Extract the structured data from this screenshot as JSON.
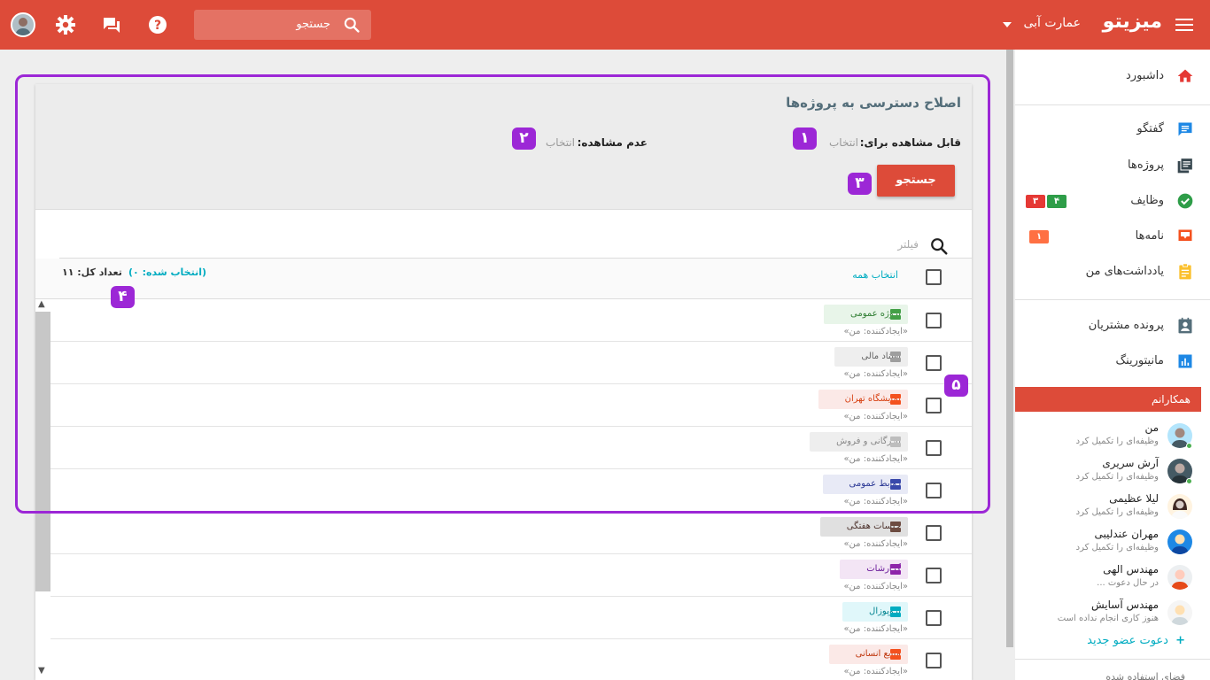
{
  "topbar": {
    "brand": "میزیتو",
    "org": "عمارت آبی",
    "search_text": "جستجو",
    "colors": {
      "bar": "#dd4b39"
    }
  },
  "sidebar": {
    "items": [
      {
        "label": "داشبورد",
        "icon": "home-icon"
      },
      {
        "label": "گفتگو",
        "icon": "chat-icon"
      },
      {
        "label": "پروژه‌ها",
        "icon": "projects-icon"
      },
      {
        "label": "وظایف",
        "icon": "check-circle-icon",
        "badges": [
          "۴",
          "۳"
        ]
      },
      {
        "label": "نامه‌ها",
        "icon": "inbox-icon",
        "badges": [
          "۱"
        ]
      },
      {
        "label": "یادداشت‌های من",
        "icon": "note-icon"
      },
      {
        "label": "پرونده مشتریان",
        "icon": "contact-card-icon"
      },
      {
        "label": "مانیتورینگ",
        "icon": "bar-chart-icon"
      }
    ],
    "colleagues_header": "همکارانم",
    "colleagues": [
      {
        "name": "من",
        "status": "وظیفه‌ای را تکمیل کرد",
        "online": true
      },
      {
        "name": "آرش سریری",
        "status": "وظیفه‌ای را تکمیل کرد",
        "online": true
      },
      {
        "name": "لیلا عظیمی",
        "status": "وظیفه‌ای را تکمیل کرد",
        "online": false
      },
      {
        "name": "مهران عندلیبی",
        "status": "وظیفه‌ای را تکمیل کرد",
        "online": false
      },
      {
        "name": "مهندس الهی",
        "status": "در حال دعوت ...",
        "online": false
      },
      {
        "name": "مهندس آسایش",
        "status": "هنوز کاری انجام نداده است",
        "online": false
      }
    ],
    "invite": "دعوت عضو جدید",
    "footer": "فضای استفاده شده"
  },
  "card": {
    "title": "اصلاح دسترسی به پروژه‌ها",
    "visible_for_label": "قابل مشاهده برای:",
    "visible_for_value": "انتخاب",
    "not_visible_label": "عدم مشاهده:",
    "not_visible_value": "انتخاب",
    "search_button": "جستجو",
    "filter_placeholder": "فیلتر",
    "select_all": "انتخاب همه",
    "selected_count": "(انتخاب شده: ۰)",
    "total_count": "تعداد کل: ۱۱"
  },
  "projects": [
    {
      "name": "پروژه عمومی",
      "creator": "«ایجادکننده: من»",
      "bg": "#e8f5e9",
      "fg": "#2e7d32",
      "ic": "#43a047"
    },
    {
      "name": "اسناد مالی",
      "creator": "«ایجادکننده: من»",
      "bg": "#eeeeee",
      "fg": "#666666",
      "ic": "#9e9e9e"
    },
    {
      "name": "نمایشگاه تهران",
      "creator": "«ایجادکننده: من»",
      "bg": "#fbe9e7",
      "fg": "#d84315",
      "ic": "#f4511e"
    },
    {
      "name": "بازرگانی و فروش",
      "creator": "«ایجادکننده: من»",
      "bg": "#eeeeee",
      "fg": "#888888",
      "ic": "#bdbdbd"
    },
    {
      "name": "روابط عمومی",
      "creator": "«ایجادکننده: من»",
      "bg": "#e8eaf6",
      "fg": "#283593",
      "ic": "#3949ab"
    },
    {
      "name": "جلسات هفتگی",
      "creator": "«ایجادکننده: من»",
      "bg": "#e0e0e0",
      "fg": "#4e342e",
      "ic": "#6d4c41"
    },
    {
      "name": "گزارشات",
      "creator": "«ایجادکننده: من»",
      "bg": "#f3e5f5",
      "fg": "#6a1b9a",
      "ic": "#8e24aa"
    },
    {
      "name": "پروپوزال",
      "creator": "«ایجادکننده: من»",
      "bg": "#e0f7fa",
      "fg": "#00838f",
      "ic": "#00acc1"
    },
    {
      "name": "منابع انسانی",
      "creator": "«ایجادکننده: من»",
      "bg": "#fbe9e7",
      "fg": "#bf360c",
      "ic": "#f4511e"
    }
  ],
  "annotations": [
    "۱",
    "۲",
    "۳",
    "۴",
    "۵"
  ]
}
